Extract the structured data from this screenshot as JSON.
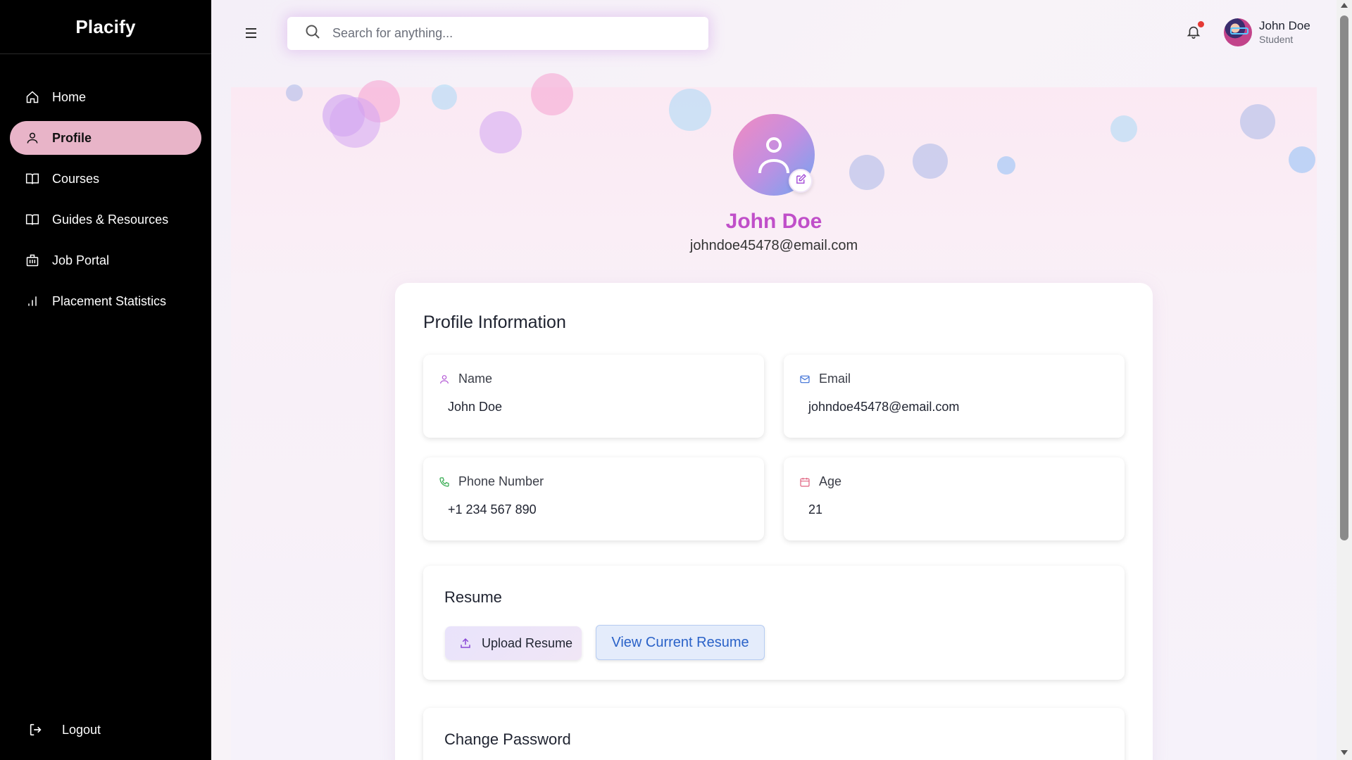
{
  "sidebar": {
    "brand": "Placify",
    "items": [
      {
        "label": "Home",
        "icon": "home-icon"
      },
      {
        "label": "Profile",
        "icon": "user-icon",
        "active": true
      },
      {
        "label": "Courses",
        "icon": "book-icon"
      },
      {
        "label": "Guides & Resources",
        "icon": "book-icon"
      },
      {
        "label": "Job Portal",
        "icon": "building-icon"
      },
      {
        "label": "Placement Statistics",
        "icon": "bar-chart-icon"
      }
    ],
    "logout": "Logout"
  },
  "topbar": {
    "search_placeholder": "Search for anything...",
    "user_name": "John Doe",
    "user_role": "Student",
    "notification_dot": true
  },
  "profile": {
    "name": "John Doe",
    "email": "johndoe45478@email.com"
  },
  "profile_info": {
    "title": "Profile Information",
    "fields": [
      {
        "label": "Name",
        "value": "John Doe",
        "icon": "user-icon"
      },
      {
        "label": "Email",
        "value": "johndoe45478@email.com",
        "icon": "mail-icon"
      },
      {
        "label": "Phone Number",
        "value": "+1 234 567 890",
        "icon": "phone-icon"
      },
      {
        "label": "Age",
        "value": "21",
        "icon": "calendar-icon"
      }
    ]
  },
  "resume": {
    "title": "Resume",
    "upload_label": "Upload Resume",
    "view_label": "View Current Resume"
  },
  "password": {
    "title": "Change Password"
  },
  "colors": {
    "accent": "#c04fc9",
    "active_nav": "#e8b4c8",
    "sidebar_bg": "#000000",
    "link_blue": "#2a62c8"
  }
}
